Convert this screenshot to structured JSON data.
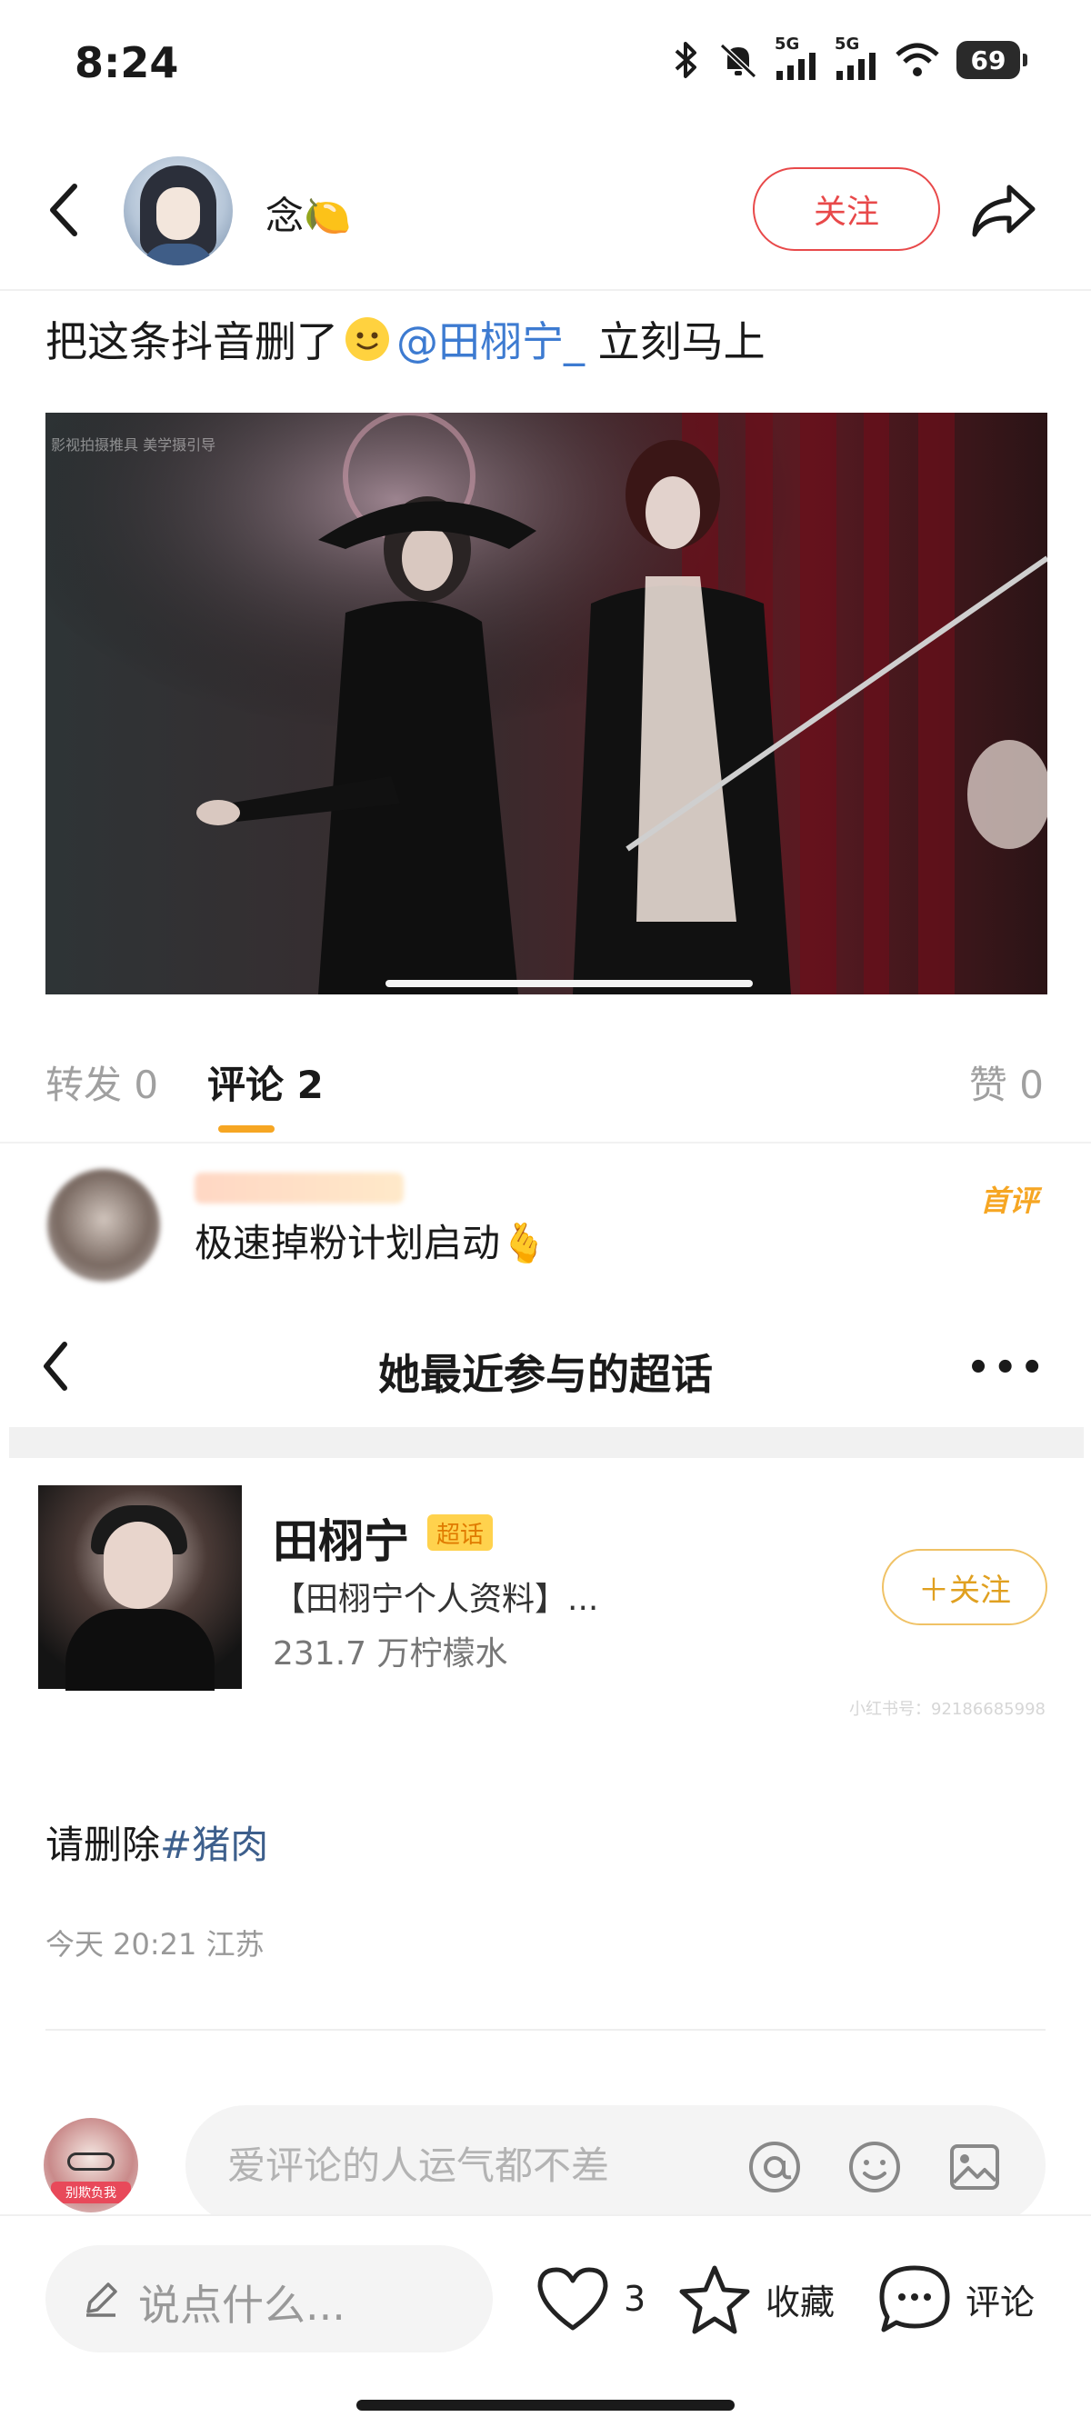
{
  "status": {
    "time": "8:24",
    "battery": "69",
    "network_1": "5G",
    "network_2": "5G"
  },
  "header": {
    "username": "念🍋",
    "follow_label": "关注"
  },
  "post": {
    "text_before": "把这条抖音删了",
    "mention": "@田栩宁_",
    "text_after": " 立刻马上",
    "image_watermark": "影视拍摄推具 美学摄引导",
    "body_text": "请删除",
    "hashtag": "#猪肉",
    "meta": "今天 20:21 江苏"
  },
  "tabs": {
    "repost": "转发 0",
    "comment": "评论 2",
    "like": "赞 0"
  },
  "comment": {
    "text": "极速掉粉计划启动🫰",
    "first_badge": "首评"
  },
  "supertopic_panel": {
    "title": "她最近参与的超话",
    "more": "•••",
    "topic": {
      "name": "田栩宁",
      "badge": "超话",
      "desc": "【田栩宁个人资料】...",
      "count": "231.7 万柠檬水",
      "follow_label": "＋关注",
      "watermark": "小红书号：92186685998"
    }
  },
  "comment_input": {
    "placeholder": "爱评论的人运气都不差",
    "avatar_tag": "别欺负我"
  },
  "bottom_bar": {
    "say_placeholder": "说点什么...",
    "like_count": "3",
    "collect_label": "收藏",
    "comment_label": "评论"
  },
  "colors": {
    "follow_red": "#e8494a",
    "accent_orange": "#f6a623",
    "mention_blue": "#3d7bd1"
  }
}
